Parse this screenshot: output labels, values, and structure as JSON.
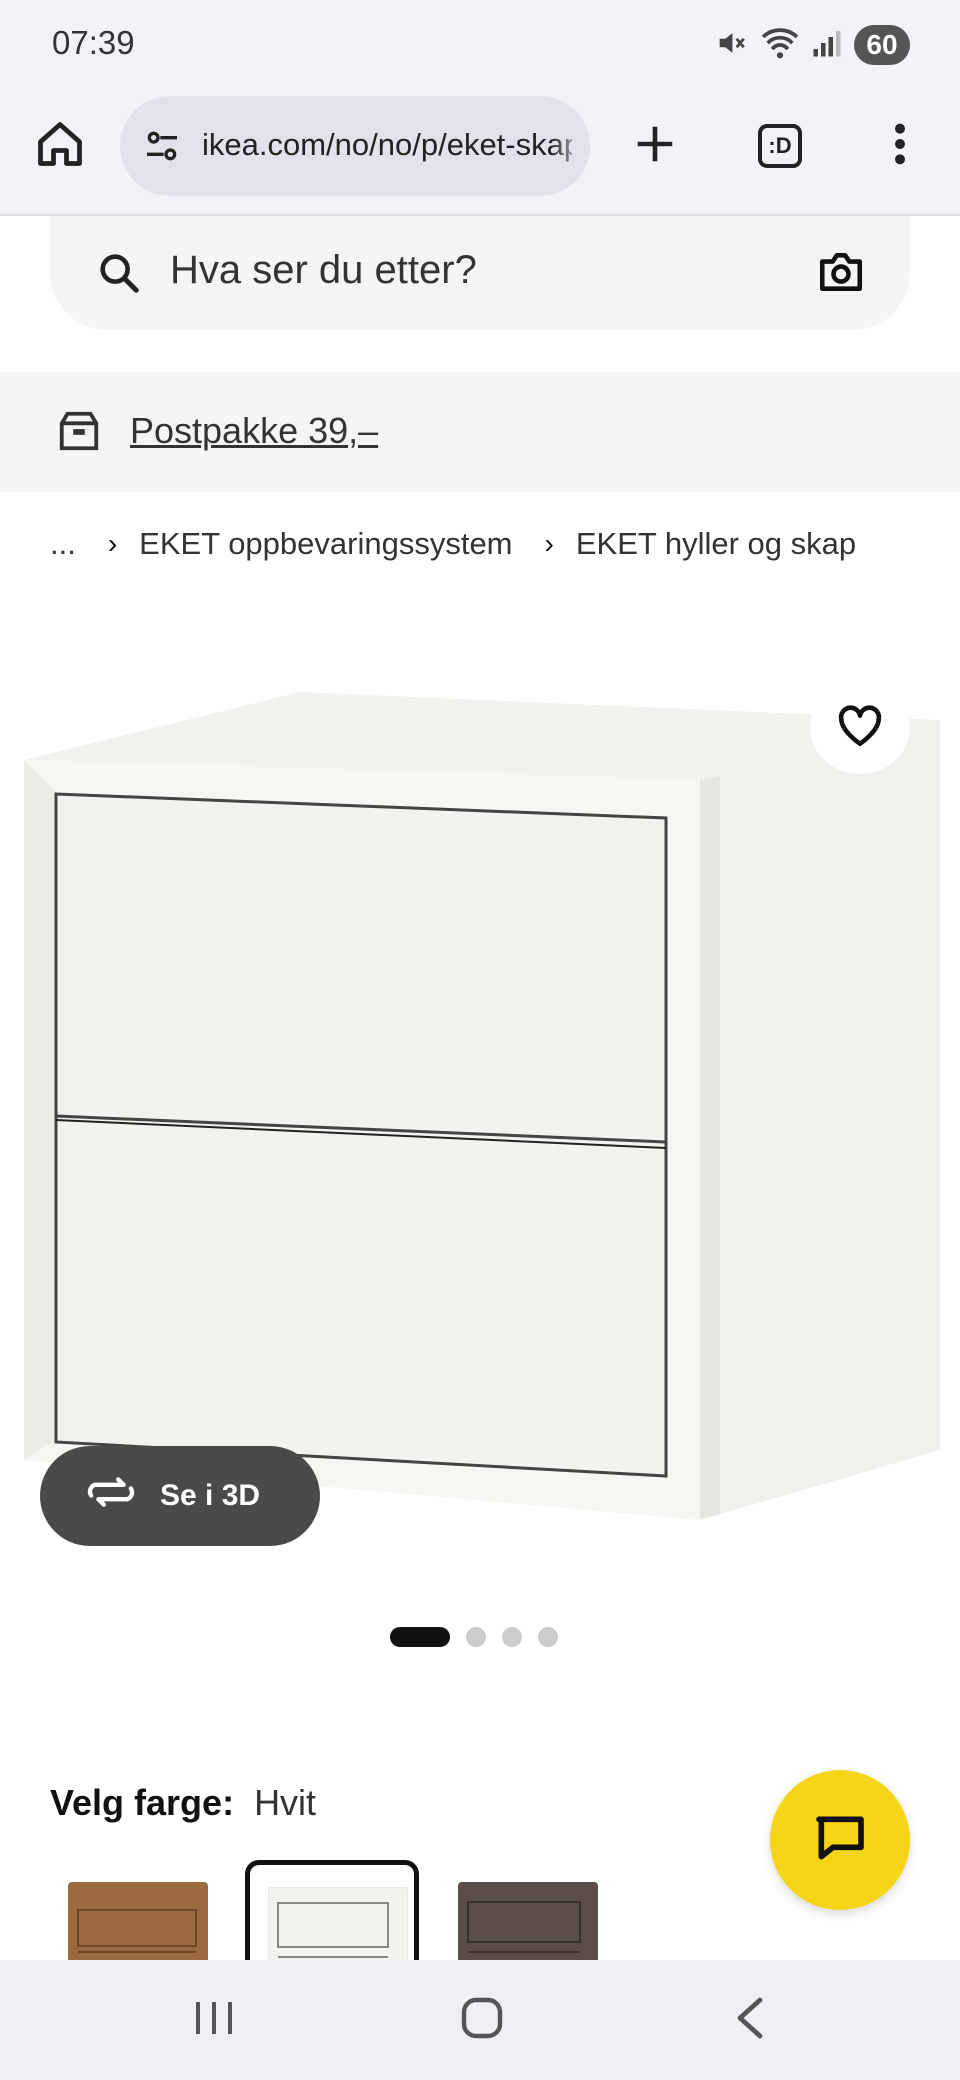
{
  "status_bar": {
    "time": "07:39",
    "battery": "60",
    "icons": [
      "mute-icon",
      "wifi-icon",
      "signal-icon",
      "battery-icon"
    ]
  },
  "browser": {
    "url": "ikea.com/no/no/p/eket-skap",
    "tabs_label": ":D",
    "icons": [
      "home-icon",
      "site-settings-icon",
      "plus-icon",
      "tabs-icon",
      "more-vert-icon"
    ]
  },
  "search": {
    "placeholder": "Hva ser du etter?",
    "icons": [
      "search-icon",
      "camera-icon"
    ]
  },
  "banner": {
    "link_text": "Postpakke 39,–",
    "icon": "package-icon"
  },
  "breadcrumb": {
    "ellipsis": "...",
    "items": [
      "EKET oppbevaringssystem",
      "EKET hyller og skap"
    ]
  },
  "product": {
    "view3d_label": "Se i 3D",
    "carousel": {
      "total": 4,
      "active": 1
    },
    "icons": [
      "heart-icon",
      "rotate-3d-icon"
    ]
  },
  "color": {
    "label": "Velg farge:",
    "value": "Hvit",
    "swatches": [
      {
        "name": "walnut",
        "color": "#9b6a3e",
        "selected": false
      },
      {
        "name": "white",
        "color": "#f2f2ef",
        "selected": true
      },
      {
        "name": "dark-grey",
        "color": "#5a4d47",
        "selected": false
      }
    ]
  },
  "chat": {
    "icon": "chat-icon",
    "color": "#f5d516"
  },
  "nav_bar": {
    "icons": [
      "recents-icon",
      "home-nav-icon",
      "back-icon"
    ]
  }
}
